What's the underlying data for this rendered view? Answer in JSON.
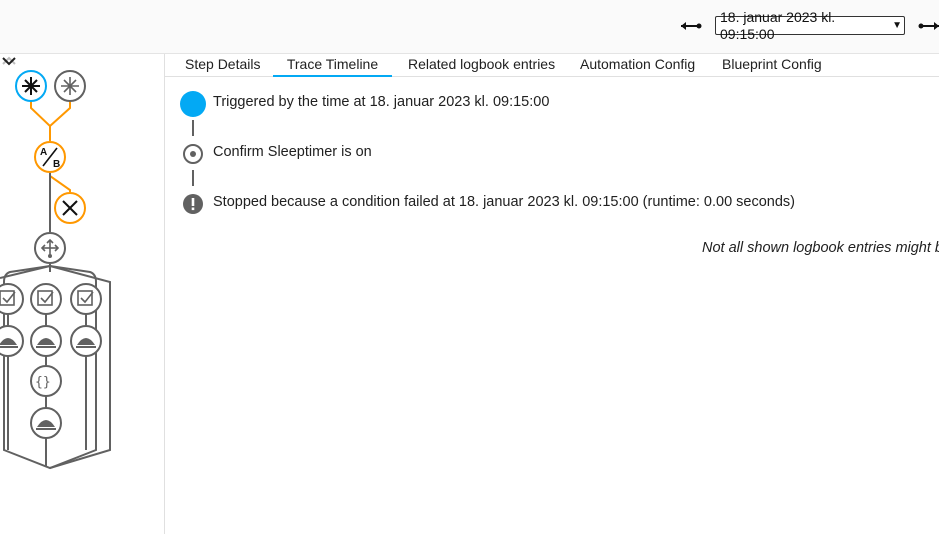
{
  "run_selector": {
    "selected": "18. januar 2023 kl. 09:15:00"
  },
  "tabs": [
    {
      "label": "Step Details"
    },
    {
      "label": "Trace Timeline"
    },
    {
      "label": "Related logbook entries"
    },
    {
      "label": "Automation Config"
    },
    {
      "label": "Blueprint Config"
    }
  ],
  "active_tab": "Trace Timeline",
  "timeline": [
    {
      "icon": "trigger-dot",
      "text": "Triggered by the time at 18. januar 2023 kl. 09:15:00"
    },
    {
      "icon": "condition-circle",
      "text": "Confirm Sleeptimer is on"
    },
    {
      "icon": "alert-circle",
      "text": "Stopped because a condition failed at 18. januar 2023 kl. 09:15:00 (runtime: 0.00 seconds)"
    }
  ],
  "logbook_note": "Not all shown logbook entries might be",
  "colors": {
    "accent": "#03a9f4",
    "active_path": "#ff9800",
    "node_gray": "#616161"
  },
  "graph_nodes": [
    "trigger-icon",
    "trigger-icon",
    "choose-icon",
    "condition-failed-icon",
    "parallel-icon",
    "check-icon",
    "check-icon",
    "check-icon",
    "service-icon",
    "service-icon",
    "service-icon",
    "code-icon",
    "service-icon"
  ]
}
